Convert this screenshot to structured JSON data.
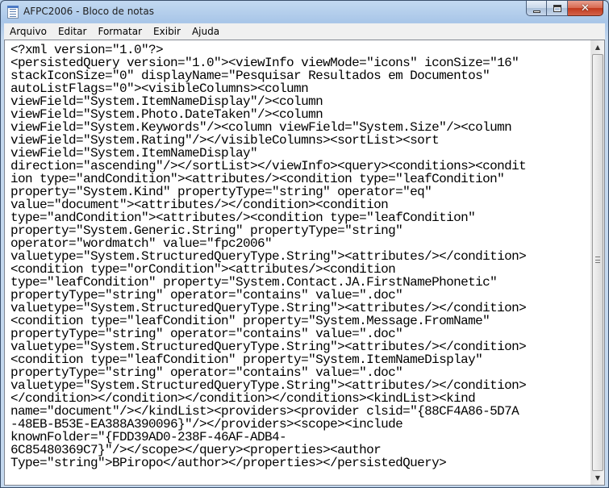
{
  "window": {
    "title": "AFPC2006 - Bloco de notas",
    "app_icon": "notepad-icon"
  },
  "caption_buttons": {
    "minimize_icon": "minimize-icon",
    "maximize_icon": "maximize-icon",
    "close_icon": "close-icon",
    "close_glyph": "✕"
  },
  "menu": {
    "items": [
      "Arquivo",
      "Editar",
      "Formatar",
      "Exibir",
      "Ajuda"
    ]
  },
  "editor": {
    "lines": [
      "<?xml version=\"1.0\"?>",
      "<persistedQuery version=\"1.0\"><viewInfo viewMode=\"icons\" iconSize=\"16\"",
      "stackIconSize=\"0\" displayName=\"Pesquisar Resultados em Documentos\"",
      "autoListFlags=\"0\"><visibleColumns><column",
      "viewField=\"System.ItemNameDisplay\"/><column",
      "viewField=\"System.Photo.DateTaken\"/><column",
      "viewField=\"System.Keywords\"/><column viewField=\"System.Size\"/><column",
      "viewField=\"System.Rating\"/></visibleColumns><sortList><sort",
      "viewField=\"System.ItemNameDisplay\"",
      "direction=\"ascending\"/></sortList></viewInfo><query><conditions><condit",
      "ion type=\"andCondition\"><attributes/><condition type=\"leafCondition\"",
      "property=\"System.Kind\" propertyType=\"string\" operator=\"eq\"",
      "value=\"document\"><attributes/></condition><condition",
      "type=\"andCondition\"><attributes/><condition type=\"leafCondition\"",
      "property=\"System.Generic.String\" propertyType=\"string\"",
      "operator=\"wordmatch\" value=\"fpc2006\"",
      "valuetype=\"System.StructuredQueryType.String\"><attributes/></condition>",
      "<condition type=\"orCondition\"><attributes/><condition",
      "type=\"leafCondition\" property=\"System.Contact.JA.FirstNamePhonetic\"",
      "propertyType=\"string\" operator=\"contains\" value=\".doc\"",
      "valuetype=\"System.StructuredQueryType.String\"><attributes/></condition>",
      "<condition type=\"leafCondition\" property=\"System.Message.FromName\"",
      "propertyType=\"string\" operator=\"contains\" value=\".doc\"",
      "valuetype=\"System.StructuredQueryType.String\"><attributes/></condition>",
      "<condition type=\"leafCondition\" property=\"System.ItemNameDisplay\"",
      "propertyType=\"string\" operator=\"contains\" value=\".doc\"",
      "valuetype=\"System.StructuredQueryType.String\"><attributes/></condition>",
      "</condition></condition></condition></conditions><kindList><kind",
      "name=\"document\"/></kindList><providers><provider clsid=\"{88CF4A86-5D7A",
      "-48EB-B53E-EA388A390096}\"/></providers><scope><include",
      "knownFolder=\"{FDD39AD0-238F-46AF-ADB4-",
      "6C85480369C7}\"/></scope></query><properties><author",
      "Type=\"string\">BPiropo</author></properties></persistedQuery>"
    ]
  },
  "scrollbar": {
    "up_icon": "scroll-up-arrow-icon",
    "down_icon": "scroll-down-arrow-icon",
    "up_glyph": "▲",
    "down_glyph": "▼"
  }
}
